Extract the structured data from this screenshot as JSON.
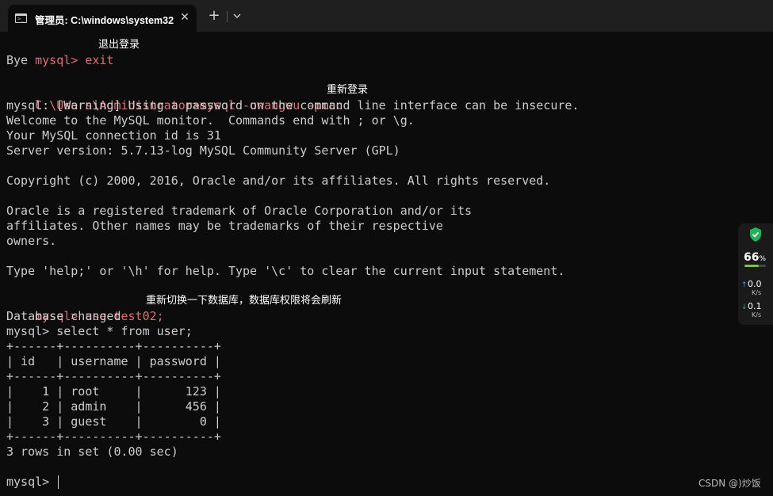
{
  "window": {
    "tab_title": "管理员: C:\\windows\\system32",
    "tab_icon": "terminal-icon",
    "close_glyph": "✕",
    "new_tab_glyph": "+",
    "dropdown_icon": "chevron-down-icon"
  },
  "terminal": {
    "l1_cmd": "mysql> exit",
    "l1_note": "退出登录",
    "l2": "Bye",
    "l4_cmd": "C:\\Users\\Administrator>mysql -uwangwu -pccc",
    "l4_note": "重新登录",
    "l5": "mysql: [Warning] Using a password on the command line interface can be insecure.",
    "l6": "Welcome to the MySQL monitor.  Commands end with ; or \\g.",
    "l7": "Your MySQL connection id is 31",
    "l8": "Server version: 5.7.13-log MySQL Community Server (GPL)",
    "l10": "Copyright (c) 2000, 2016, Oracle and/or its affiliates. All rights reserved.",
    "l12": "Oracle is a registered trademark of Oracle Corporation and/or its",
    "l13": "affiliates. Other names may be trademarks of their respective",
    "l14": "owners.",
    "l16": "Type 'help;' or '\\h' for help. Type '\\c' to clear the current input statement.",
    "l18_cmd": "mysql> use test02;",
    "l18_note": "重新切换一下数据库，数据库权限将会刷新",
    "l19": "Database changed",
    "l20": "mysql> select * from user;",
    "t_border": "+------+----------+----------+",
    "t_header": "| id   | username | password |",
    "t_rows": [
      "|    1 | root     |      123 |",
      "|    2 | admin    |      456 |",
      "|    3 | guest    |        0 |"
    ],
    "l28": "3 rows in set (0.00 sec)",
    "prompt": "mysql> "
  },
  "widget": {
    "shield_icon": "shield-check-icon",
    "percent": "66",
    "percent_unit": "%",
    "percent_fraction": 0.66,
    "bar_color": "#7ec23b",
    "up_value": "0.0",
    "up_unit": "K/s",
    "down_value": "0.1",
    "down_unit": "K/s"
  },
  "watermark": "CSDN @)炒饭",
  "colors": {
    "background": "#0c0c0c",
    "text": "#cccccc",
    "command": "#e06c75"
  }
}
